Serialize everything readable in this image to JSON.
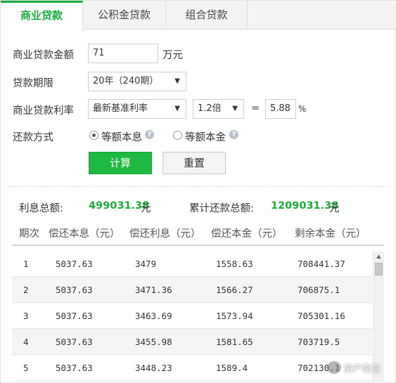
{
  "tabs": [
    "商业贷款",
    "公积金贷款",
    "组合贷款"
  ],
  "form": {
    "amount_label": "商业贷款金额",
    "amount_value": "71",
    "amount_unit": "万元",
    "term_label": "贷款期限",
    "term_value": "20年（240期）",
    "rate_label": "商业贷款利率",
    "rate_type": "最新基准利率",
    "rate_multiplier": "1.2倍",
    "equals": "=",
    "rate_value": "5.88",
    "rate_unit": "%",
    "method_label": "还款方式",
    "method_options": [
      "等额本息",
      "等额本金"
    ],
    "calc_button": "计算",
    "reset_button": "重置"
  },
  "summary": {
    "interest_label": "利息总额:",
    "interest_value": "499031.38",
    "interest_unit": "元",
    "total_label": "累计还款总额:",
    "total_value": "1209031.38",
    "total_unit": "元"
  },
  "table": {
    "headers": [
      "期次",
      "偿还本息（元）",
      "偿还利息（元）",
      "偿还本金（元）",
      "剩余本金（元）"
    ],
    "rows": [
      [
        "1",
        "5037.63",
        "3479",
        "1558.63",
        "708441.37"
      ],
      [
        "2",
        "5037.63",
        "3471.36",
        "1566.27",
        "706875.1"
      ],
      [
        "3",
        "5037.63",
        "3463.69",
        "1573.94",
        "705301.16"
      ],
      [
        "4",
        "5037.63",
        "3455.98",
        "1581.65",
        "703719.5"
      ],
      [
        "5",
        "5037.63",
        "3448.23",
        "1589.4",
        "702130.1"
      ]
    ]
  },
  "watermark": "房产南京",
  "icons": {
    "help": "help-icon",
    "scroll": "scroll-up-arrow-icon",
    "dropdown": "chevron-down-icon"
  },
  "colors": {
    "accent": "#1aab3a",
    "button": "#1db942"
  }
}
